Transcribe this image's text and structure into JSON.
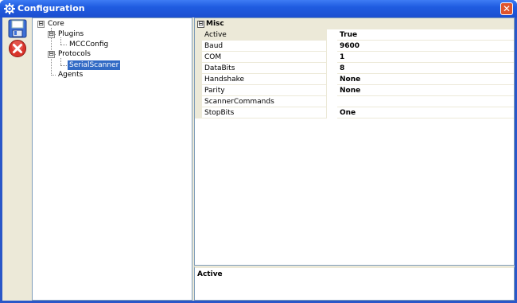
{
  "window": {
    "title": "Configuration",
    "close_label": "✕"
  },
  "toolbar": {
    "icons": [
      "save-icon",
      "cancel-icon"
    ]
  },
  "tree": {
    "nodes": [
      {
        "label": "Core",
        "expander": "⊟"
      },
      {
        "label": "Plugins",
        "expander": "⊟"
      },
      {
        "label": "MCCConfig"
      },
      {
        "label": "Protocols",
        "expander": "⊟"
      },
      {
        "label": "SerialScanner",
        "selected": true
      },
      {
        "label": "Agents"
      }
    ]
  },
  "grid": {
    "category": {
      "label": "Misc",
      "toggle": "⊟"
    },
    "properties": [
      {
        "name": "Active",
        "value": "True"
      },
      {
        "name": "Baud",
        "value": "9600"
      },
      {
        "name": "COM",
        "value": "1"
      },
      {
        "name": "DataBits",
        "value": "8"
      },
      {
        "name": "Handshake",
        "value": "None"
      },
      {
        "name": "Parity",
        "value": "None"
      },
      {
        "name": "ScannerCommands",
        "value": ""
      },
      {
        "name": "StopBits",
        "value": "One"
      }
    ]
  },
  "description": {
    "title": "Active"
  },
  "colors": {
    "titlebar": "#1f5ce0",
    "selection": "#316ac5",
    "close_button": "#e0552d"
  }
}
